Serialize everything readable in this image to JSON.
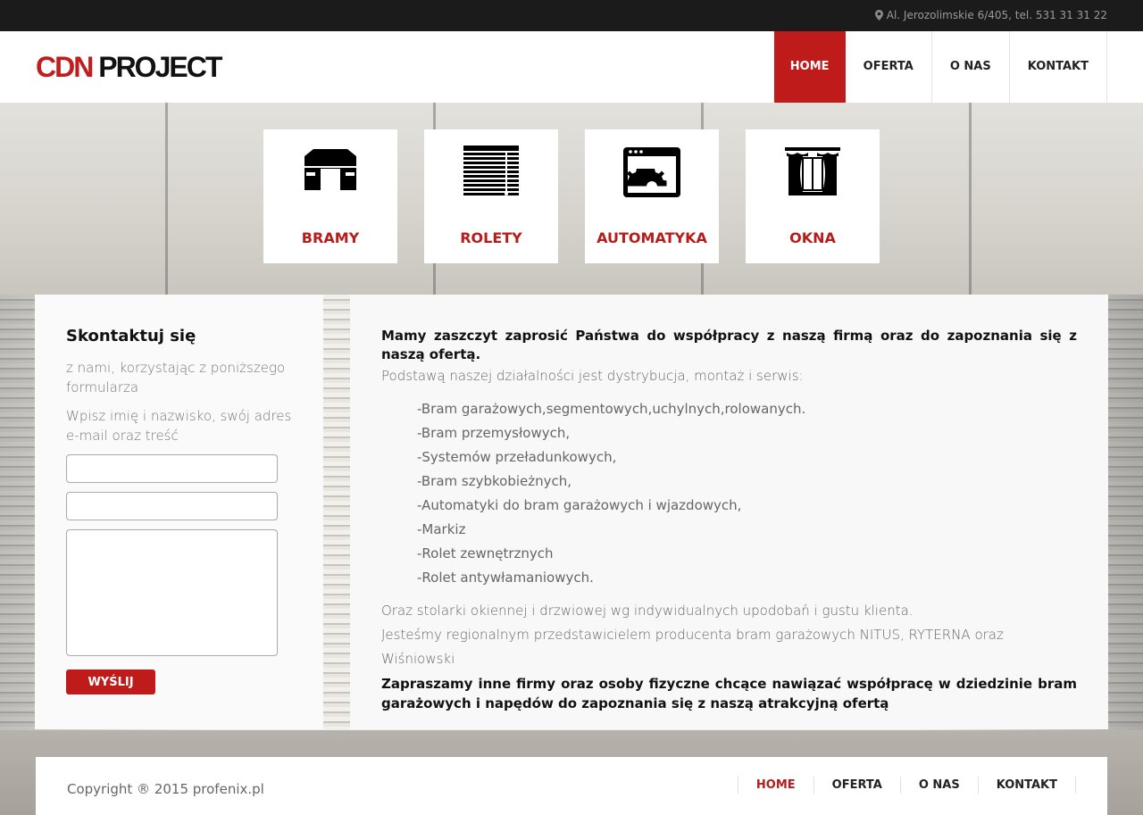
{
  "topbar": {
    "address": "Al. Jerozolimskie 6/405, tel. 531 31 31 22"
  },
  "logo": {
    "part1": "CDN",
    "part2": " PROJECT"
  },
  "nav": {
    "items": [
      "HOME",
      "OFERTA",
      "O NAS",
      "KONTAKT"
    ],
    "active": "HOME"
  },
  "tiles": [
    {
      "label": "BRAMY",
      "icon": "garage-gate-icon"
    },
    {
      "label": "ROLETY",
      "icon": "roller-blind-icon"
    },
    {
      "label": "AUTOMATYKA",
      "icon": "automation-gear-icon"
    },
    {
      "label": "OKNA",
      "icon": "window-curtain-icon"
    }
  ],
  "contact": {
    "title": "Skontaktuj się",
    "intro": "z nami, korzystając z poniższego formularza",
    "instruction": "Wpisz imię i nazwisko, swój adres e-mail oraz treść",
    "name_value": "",
    "email_value": "",
    "message_value": "",
    "send_label": "WYŚLIJ"
  },
  "content": {
    "lead": "Mamy zaszczyt zaprosić Państwa do współpracy z naszą firmą oraz do zapoznania się z naszą ofertą.",
    "intro": "Podstawą naszej działalności jest dystrybucja, montaż i serwis:",
    "services": [
      "-Bram garażowych,segmentowych,uchylnych,rolowanych.",
      "-Bram przemysłowych,",
      "-Systemów przeładunkowych,",
      "-Bram szybkobieżnych,",
      "-Automatyki do bram garażowych i wjazdowych,",
      "-Markiz",
      "-Rolet zewnętrznych",
      "-Rolet antywłamaniowych."
    ],
    "extra1": "Oraz stolarki okiennej i drzwiowej wg indywidualnych upodobań i gustu klienta.",
    "extra2": "Jesteśmy regionalnym przedstawicielem producenta bram garażowych NITUS, RYTERNA oraz Wiśniowski",
    "closing": "Zapraszamy inne firmy oraz osoby fizyczne chcące nawiązać współpracę w dziedzinie bram garażowych i napędów do zapoznania się z naszą atrakcyjną ofertą"
  },
  "footer": {
    "copyright": "Copyright ® 2015 profenix.pl",
    "nav": [
      "HOME",
      "OFERTA",
      "O NAS",
      "KONTAKT"
    ],
    "active": "HOME"
  },
  "colors": {
    "accent": "#c01b1b",
    "topbar": "#1b1b1b"
  }
}
